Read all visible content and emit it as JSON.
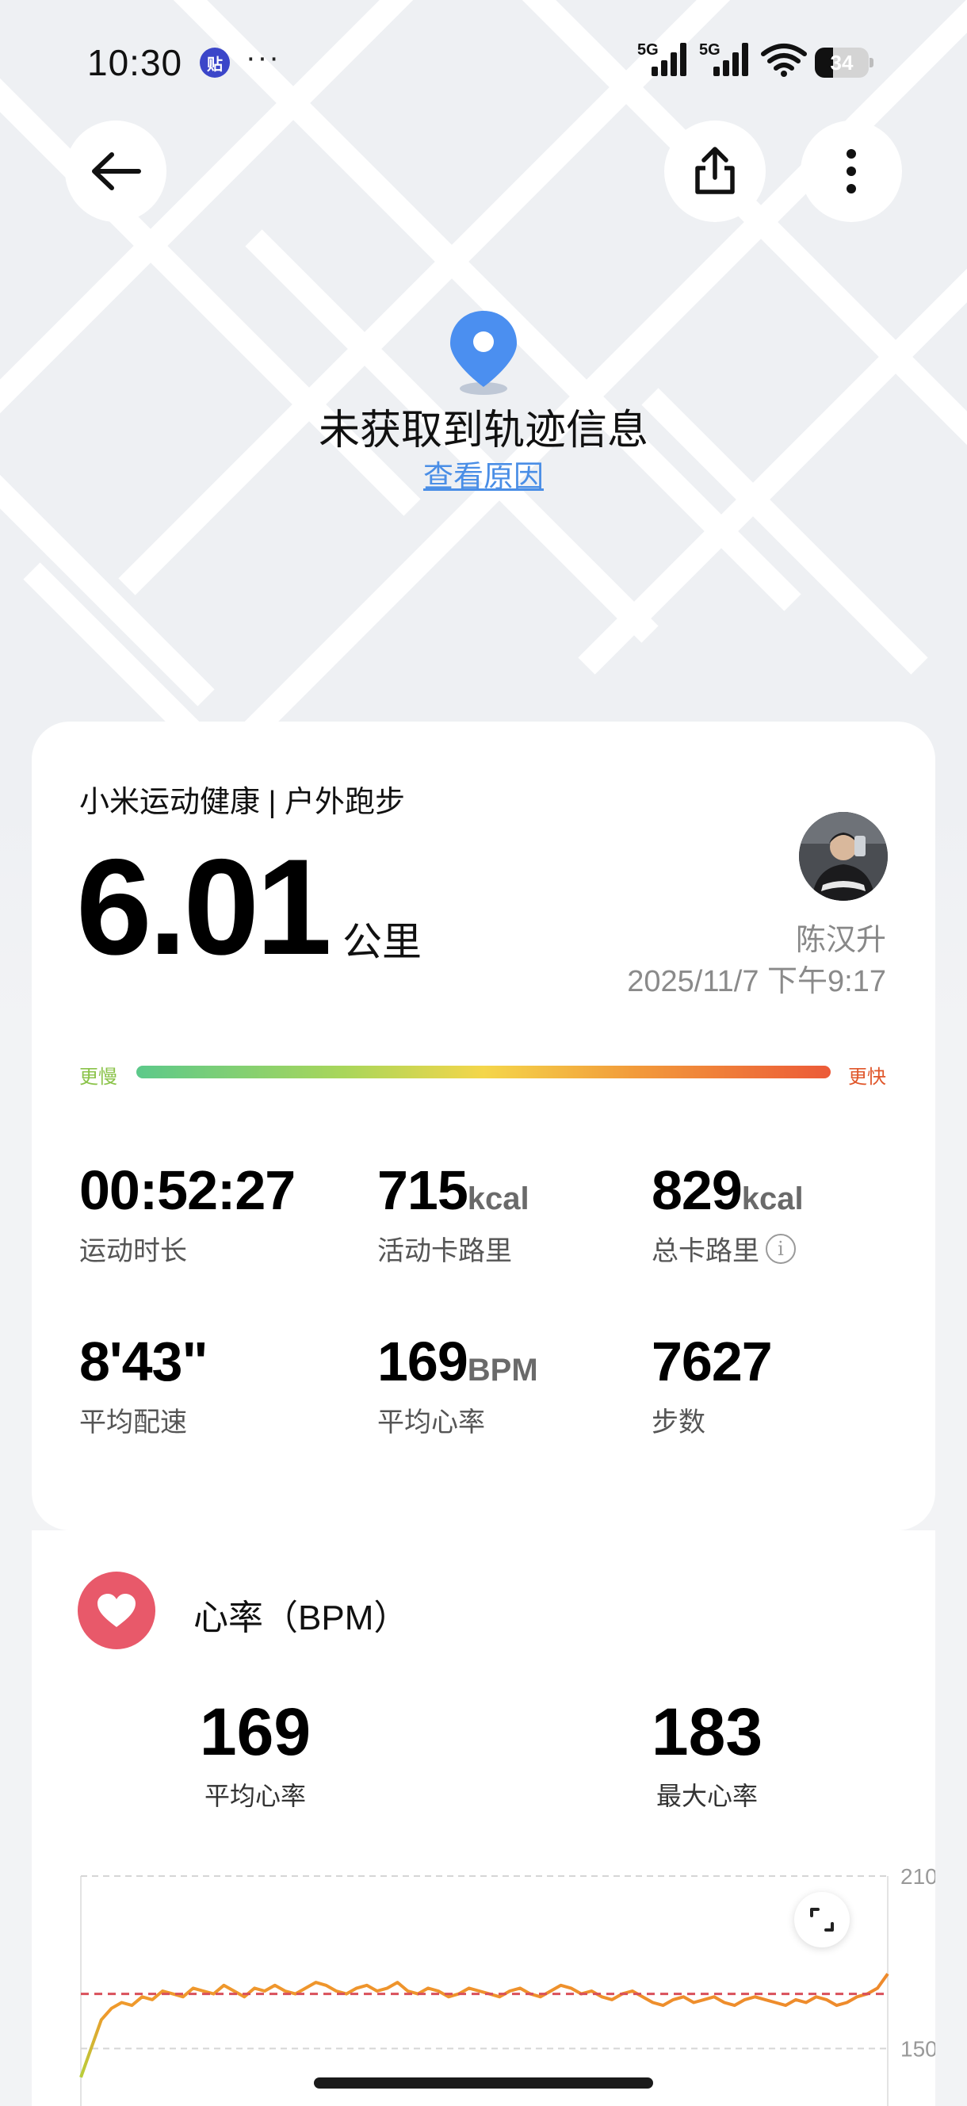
{
  "status_bar": {
    "time": "10:30",
    "app_badge": "贴",
    "more": "···",
    "signal1_label": "5G",
    "signal2_label": "5G",
    "battery": "34",
    "battery_level": 0.34
  },
  "map": {
    "no_track_text": "未获取到轨迹信息",
    "view_reason_link": "查看原因",
    "pin_color": "#4b8ff0"
  },
  "workout": {
    "source": "小米运动健康 | 户外跑步",
    "distance": "6.01",
    "distance_unit": "公里",
    "user_name": "陈汉升",
    "date_time": "2025/11/7 下午9:17",
    "pace_slow_label": "更慢",
    "pace_fast_label": "更快",
    "stats": [
      {
        "value": "00:52:27",
        "unit": "",
        "label": "运动时长"
      },
      {
        "value": "715",
        "unit": "kcal",
        "label": "活动卡路里"
      },
      {
        "value": "829",
        "unit": "kcal",
        "label": "总卡路里"
      },
      {
        "value": "8'43\"",
        "unit": "",
        "label": "平均配速"
      },
      {
        "value": "169",
        "unit": "BPM",
        "label": "平均心率"
      },
      {
        "value": "7627",
        "unit": "",
        "label": "步数"
      }
    ]
  },
  "heart_rate": {
    "title": "心率（BPM）",
    "avg_value": "169",
    "avg_label": "平均心率",
    "max_value": "183",
    "max_label": "最大心率",
    "accent_color": "#e8596a"
  },
  "chart_data": {
    "type": "line",
    "title": "",
    "xlabel": "",
    "ylabel": "",
    "ylim": [
      130,
      210
    ],
    "y_ticks": [
      "210",
      "150"
    ],
    "avg_line": 169,
    "series": [
      {
        "values": [
          140,
          150,
          160,
          164,
          166,
          165,
          168,
          167,
          170,
          169,
          168,
          171,
          170,
          169,
          172,
          170,
          168,
          171,
          170,
          172,
          170,
          169,
          171,
          173,
          172,
          170,
          169,
          171,
          172,
          170,
          171,
          173,
          170,
          169,
          171,
          170,
          168,
          169,
          171,
          170,
          169,
          168,
          170,
          171,
          169,
          168,
          170,
          172,
          171,
          169,
          170,
          168,
          167,
          169,
          170,
          168,
          166,
          165,
          167,
          168,
          166,
          167,
          168,
          166,
          165,
          167,
          168,
          167,
          166,
          165,
          167,
          166,
          168,
          167,
          165,
          166,
          168,
          169,
          171,
          176
        ]
      }
    ]
  }
}
